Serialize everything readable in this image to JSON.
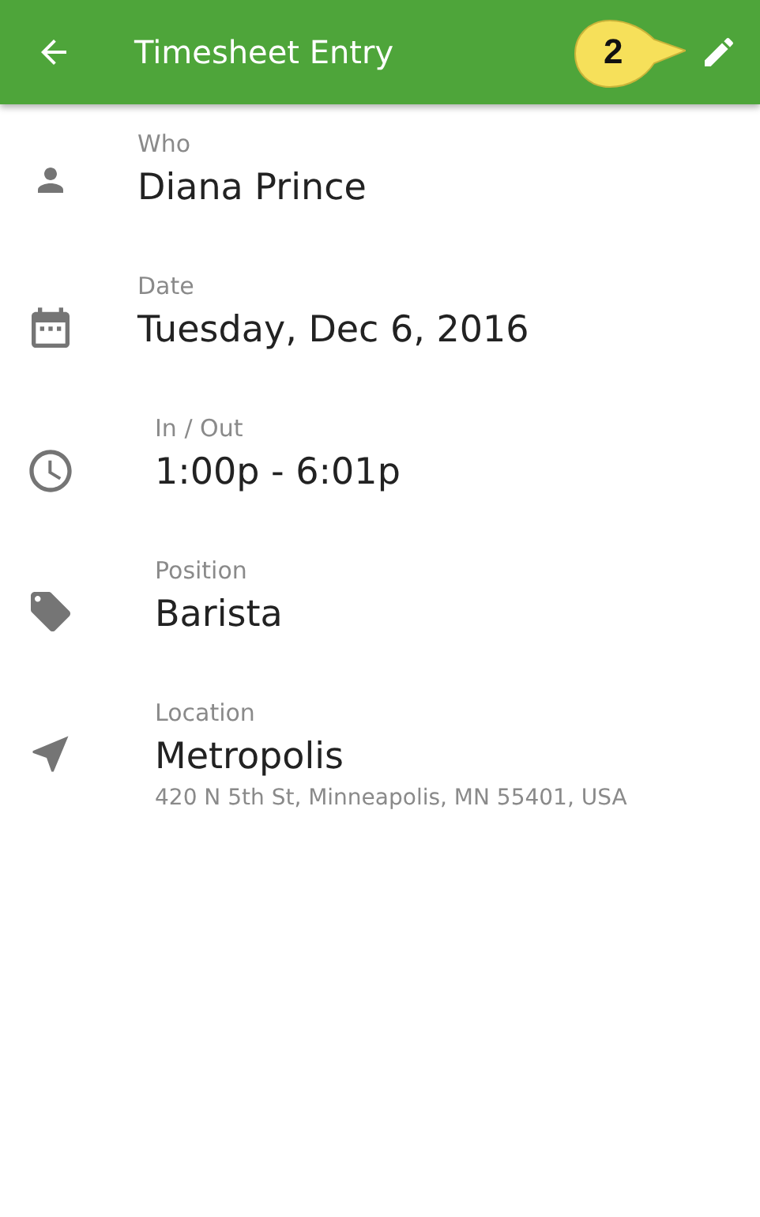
{
  "app_bar": {
    "title": "Timesheet Entry"
  },
  "callout": {
    "label": "2"
  },
  "fields": [
    {
      "kind": "person",
      "label": "Who",
      "value": "Diana Prince"
    },
    {
      "kind": "calendar",
      "label": "Date",
      "value": "Tuesday, Dec 6, 2016"
    },
    {
      "kind": "clock",
      "label": "In / Out",
      "value": "1:00p - 6:01p"
    },
    {
      "kind": "tag",
      "label": "Position",
      "value": "Barista"
    },
    {
      "kind": "location",
      "label": "Location",
      "value": "Metropolis",
      "detail": "420 N 5th St, Minneapolis, MN 55401, USA"
    }
  ]
}
